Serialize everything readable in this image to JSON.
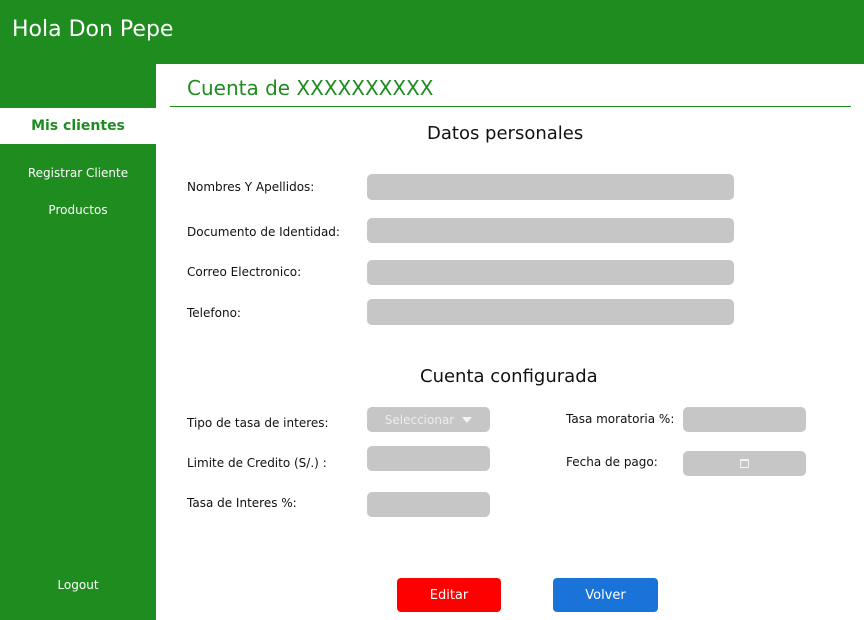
{
  "header": {
    "title": "Hola Don Pepe"
  },
  "sidebar": {
    "active": "Mis clientes",
    "items": [
      {
        "label": "Registrar Cliente"
      },
      {
        "label": "Productos"
      }
    ],
    "logout": "Logout"
  },
  "page": {
    "title": "Cuenta de XXXXXXXXXX"
  },
  "personal": {
    "title": "Datos personales",
    "fields": [
      {
        "label": "Nombres Y Apellidos:",
        "value": ""
      },
      {
        "label": "Documento de Identidad:",
        "value": ""
      },
      {
        "label": "Correo Electronico:",
        "value": ""
      },
      {
        "label": "Telefono:",
        "value": ""
      }
    ]
  },
  "account": {
    "title": "Cuenta configurada",
    "rate_type_label": "Tipo de tasa de interes:",
    "rate_type_value": "Seleccionar",
    "credit_limit_label": "Limite de Credito (S/.) :",
    "interest_rate_label": "Tasa de Interes %:",
    "late_rate_label": "Tasa moratoria %:",
    "payment_date_label": "Fecha de pago:"
  },
  "buttons": {
    "edit": "Editar",
    "back": "Volver"
  },
  "colors": {
    "primary_green": "#1f8c1f",
    "field_gray": "#c6c6c6",
    "edit_red": "#ff0000",
    "back_blue": "#1a73d9"
  },
  "icons": {
    "select": "caret-down-icon",
    "date": "calendar-icon"
  }
}
